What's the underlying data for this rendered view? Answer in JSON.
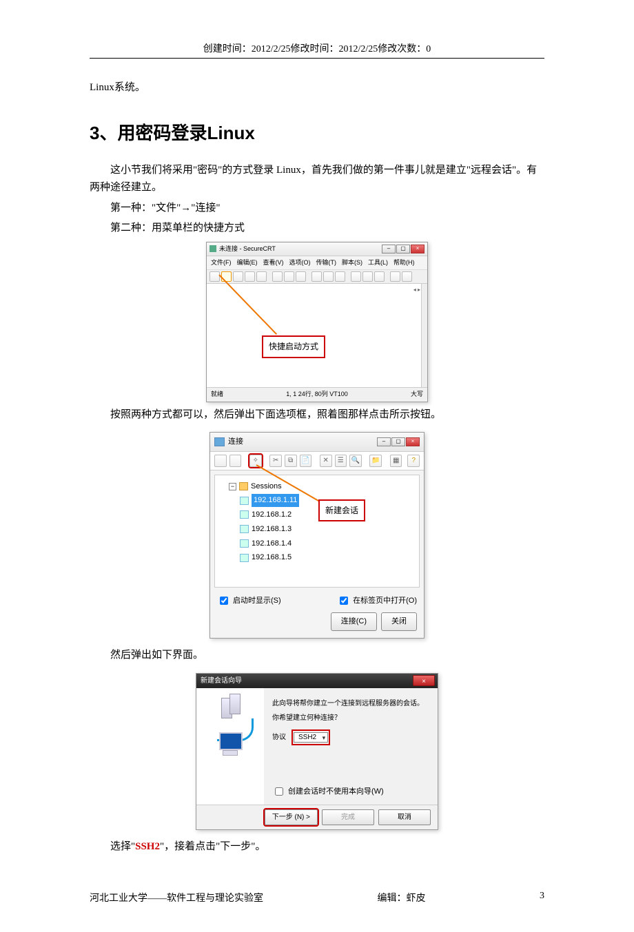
{
  "header": "创建时间：2012/2/25修改时间：2012/2/25修改次数：0",
  "intro_prev": "Linux系统。",
  "section_title": "3、用密码登录Linux",
  "para1": "这小节我们将采用\"密码\"的方式登录 Linux，首先我们做的第一件事儿就是建立\"远程会话\"。有两种途径建立。",
  "way1": "第一种：\"文件\"→\"连接\"",
  "way2": "第二种：用菜单栏的快捷方式",
  "win1": {
    "title": "未连接 - SecureCRT",
    "menus": [
      "文件(F)",
      "编辑(E)",
      "查看(V)",
      "选项(O)",
      "传输(T)",
      "脚本(S)",
      "工具(L)",
      "帮助(H)"
    ],
    "callout": "快捷启动方式",
    "status_left": "就绪",
    "status_mid": "1,  1    24行, 80列  VT100",
    "status_right": "大写"
  },
  "para2": "按照两种方式都可以，然后弹出下面选项框，照着图那样点击所示按钮。",
  "dlg": {
    "title": "连接",
    "callout": "新建会话",
    "tree_root": "Sessions",
    "sessions": [
      "192.168.1.11",
      "192.168.1.2",
      "192.168.1.3",
      "192.168.1.4",
      "192.168.1.5"
    ],
    "selected_index": 0,
    "check_startup": "启动时显示(S)",
    "check_tab": "在标签页中打开(O)",
    "btn_connect": "连接(C)",
    "btn_close": "关闭"
  },
  "para3": "然后弹出如下界面。",
  "wiz": {
    "title": "新建会话向导",
    "line1": "此向导将帮你建立一个连接到远程服务器的会话。",
    "line2": "你希望建立何种连接？",
    "proto_label": "协议",
    "proto_value": "SSH2",
    "check_nowiz": "创建会话时不使用本向导(W)",
    "btn_next": "下一步 (N) >",
    "btn_finish": "完成",
    "btn_cancel": "取消"
  },
  "para4_pre": "选择\"",
  "para4_ssh": "SSH2",
  "para4_post": "\"，接着点击\"下一步\"。",
  "footer_left": "河北工业大学——软件工程与理论实验室",
  "footer_mid": "编辑：虾皮",
  "footer_page": "3"
}
